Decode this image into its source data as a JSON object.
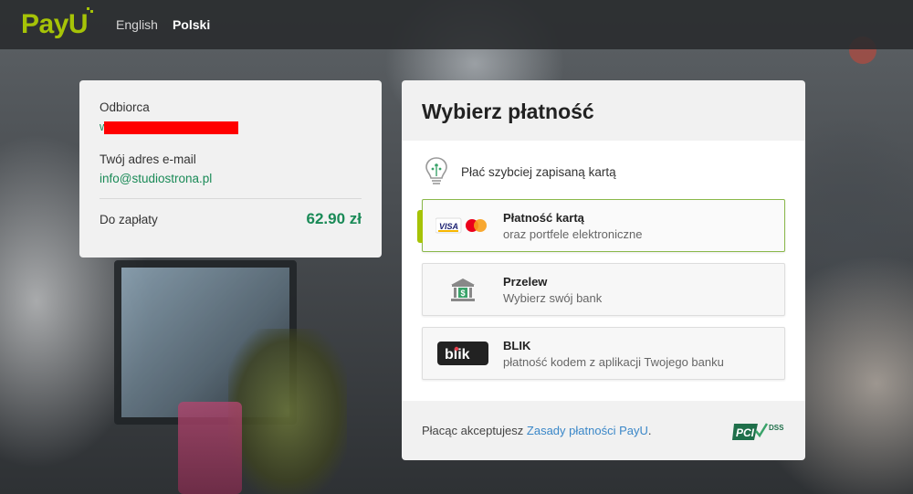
{
  "header": {
    "logo": "PayU",
    "languages": [
      {
        "label": "English",
        "active": false
      },
      {
        "label": "Polski",
        "active": true
      }
    ]
  },
  "summary": {
    "recipient_label": "Odbiorca",
    "recipient_visible_char": "w",
    "email_label": "Twój adres e-mail",
    "email_value": "info@studiostrona.pl",
    "amount_label": "Do zapłaty",
    "amount_value": "62.90 zł"
  },
  "payment": {
    "title": "Wybierz płatność",
    "saved_card_text": "Płać szybciej zapisaną kartą",
    "methods": [
      {
        "title": "Płatność kartą",
        "subtitle": "oraz portfele elektroniczne",
        "icon": "visa-mastercard-icon",
        "selected": true
      },
      {
        "title": "Przelew",
        "subtitle": "Wybierz swój bank",
        "icon": "bank-icon",
        "selected": false
      },
      {
        "title": "BLIK",
        "subtitle": "płatność kodem z aplikacji Twojego banku",
        "icon": "blik-icon",
        "selected": false
      }
    ],
    "footer_text": "Płacąc akceptujesz ",
    "footer_link": "Zasady płatności PayU",
    "footer_end": ".",
    "badge_text": "DSS",
    "badge_prefix": "PCI"
  },
  "colors": {
    "brand": "#a6c307",
    "accent_green": "#1a8a57",
    "link": "#3a87c8"
  }
}
